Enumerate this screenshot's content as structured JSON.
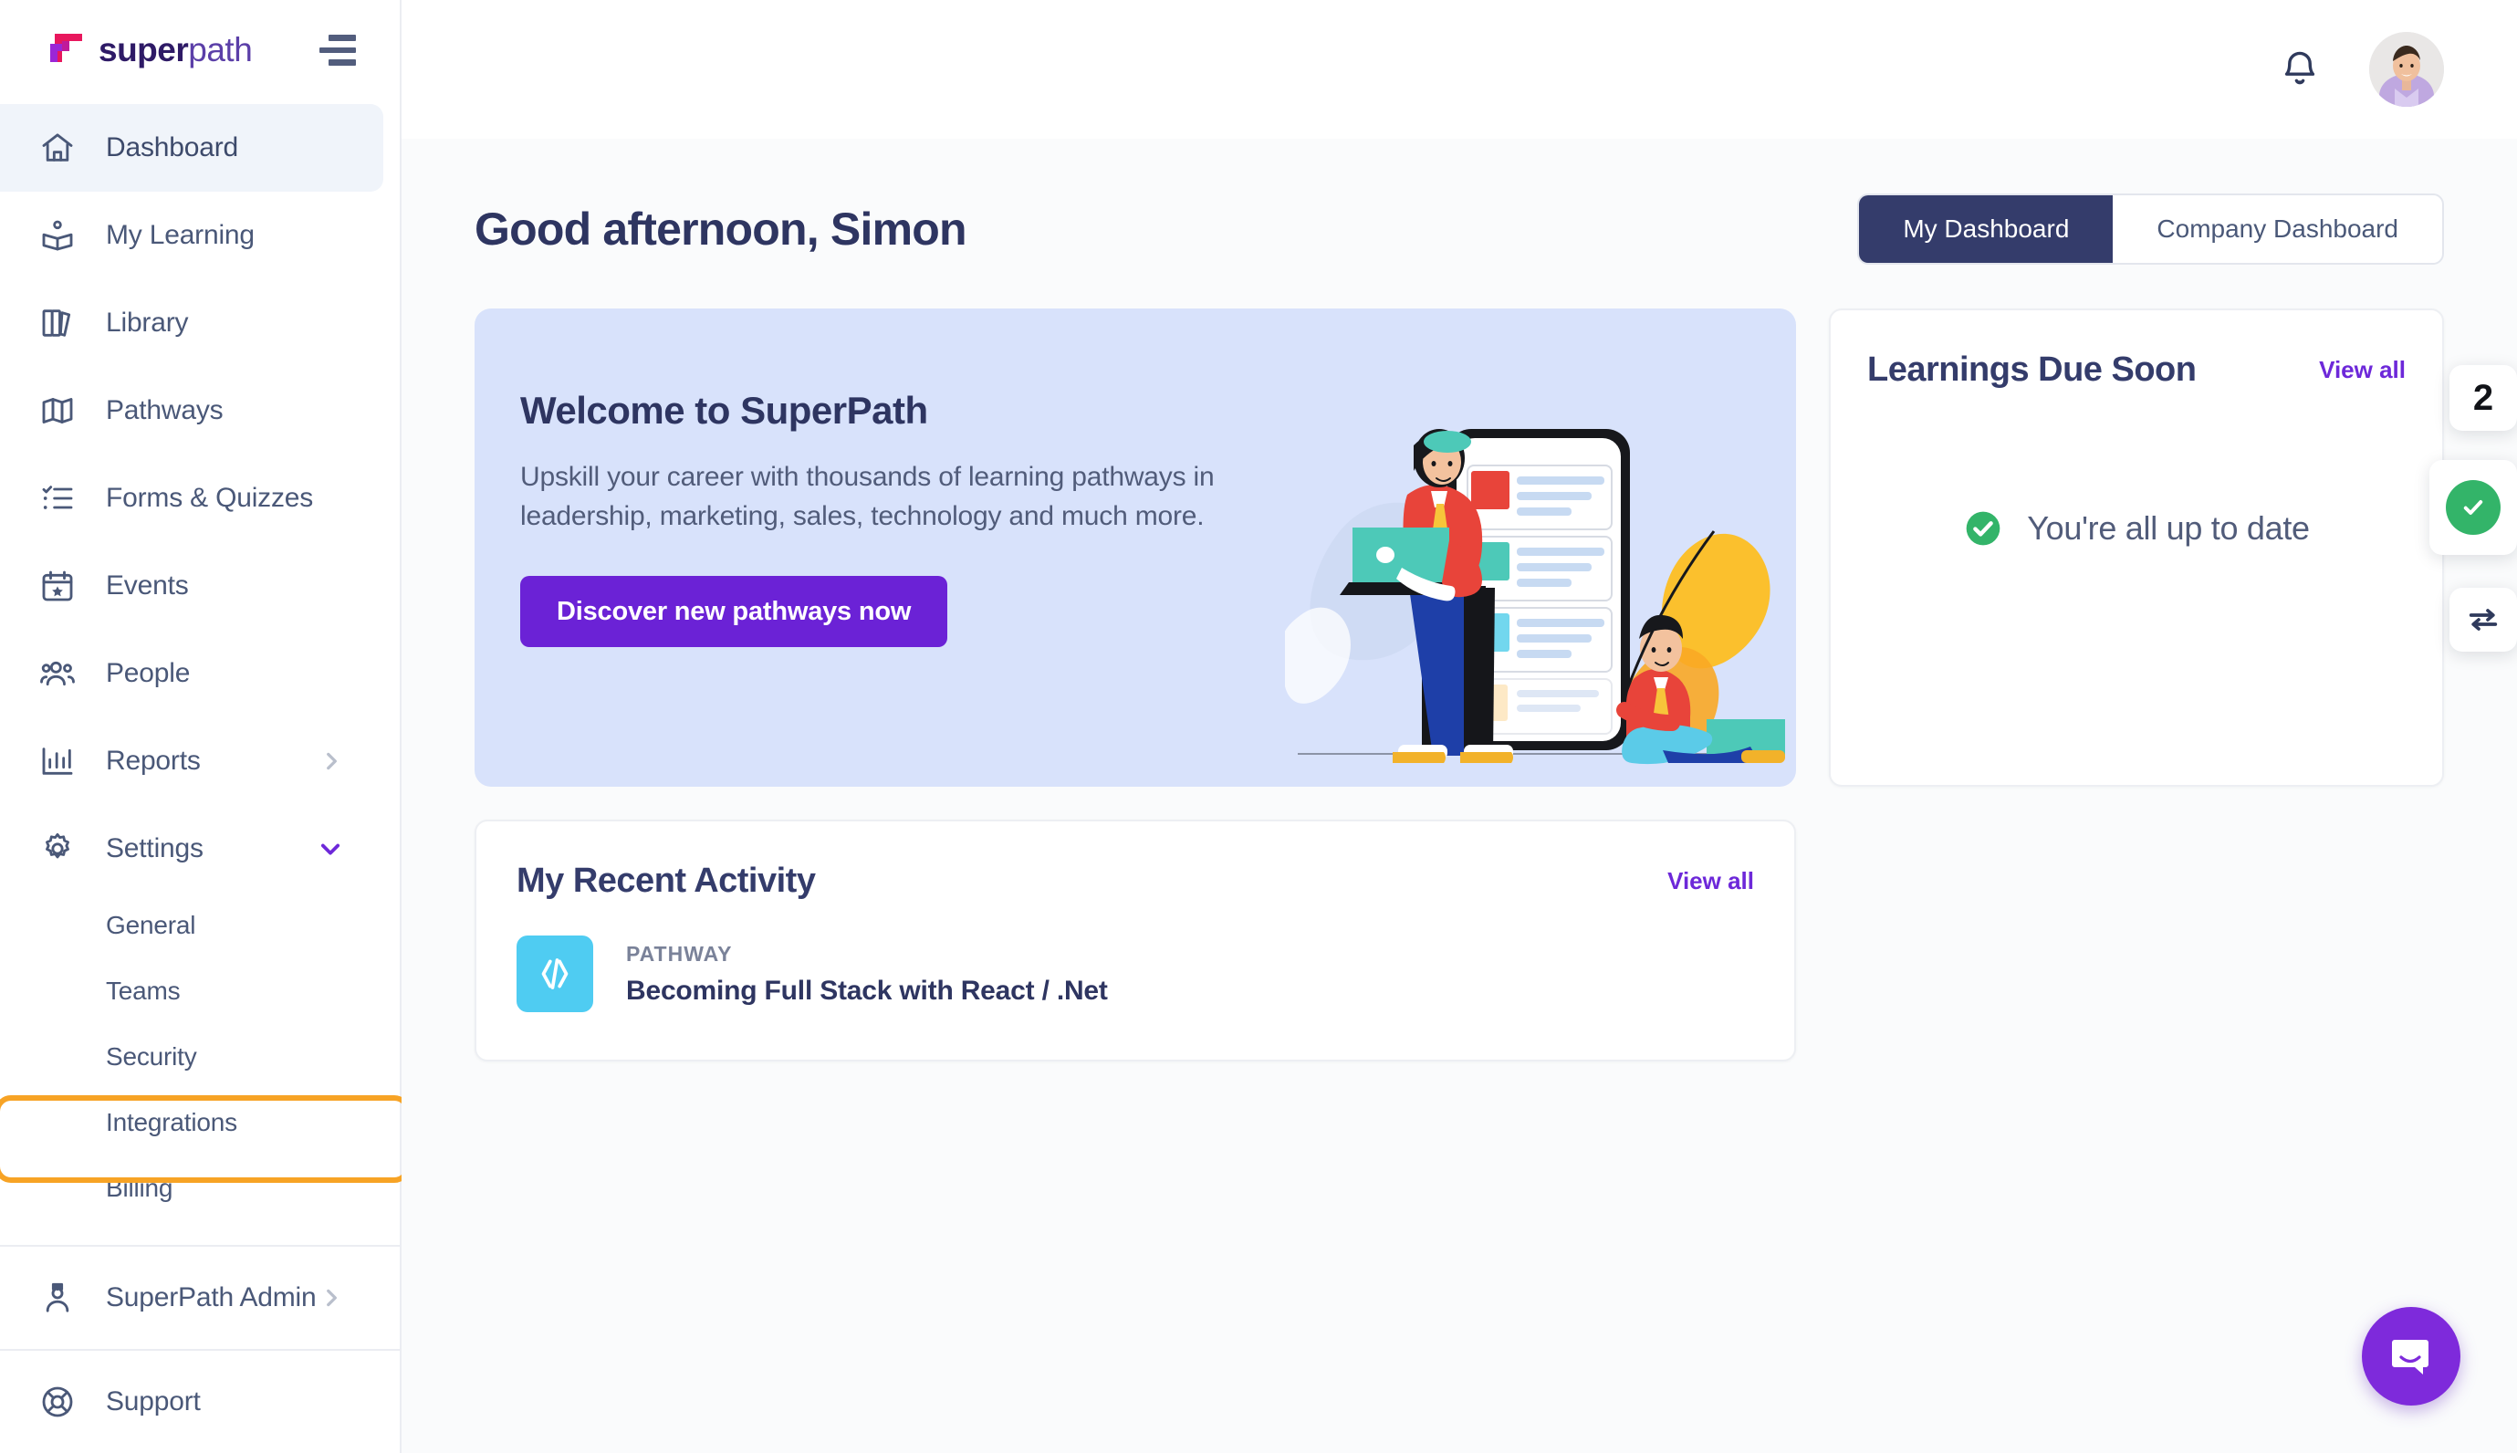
{
  "brand": {
    "logo_bold": "super",
    "logo_light": "path",
    "accent_purple": "#6B22D6",
    "accent_navy": "#343C6B",
    "highlight_orange": "#F7A325",
    "success_green": "#33B469"
  },
  "sidebar": {
    "menu_icon": "hamburger-icon",
    "items": [
      {
        "label": "Dashboard",
        "icon": "home-icon",
        "active": true,
        "chevron": "none"
      },
      {
        "label": "My Learning",
        "icon": "book-open-icon",
        "active": false,
        "chevron": "none"
      },
      {
        "label": "Library",
        "icon": "books-icon",
        "active": false,
        "chevron": "none"
      },
      {
        "label": "Pathways",
        "icon": "map-icon",
        "active": false,
        "chevron": "none"
      },
      {
        "label": "Forms & Quizzes",
        "icon": "checklist-icon",
        "active": false,
        "chevron": "none"
      },
      {
        "label": "Events",
        "icon": "calendar-star-icon",
        "active": false,
        "chevron": "none"
      },
      {
        "label": "People",
        "icon": "users-icon",
        "active": false,
        "chevron": "none"
      },
      {
        "label": "Reports",
        "icon": "bar-chart-icon",
        "active": false,
        "chevron": "right"
      },
      {
        "label": "Settings",
        "icon": "gear-icon",
        "active": false,
        "chevron": "down"
      }
    ],
    "settings_children": [
      {
        "label": "General"
      },
      {
        "label": "Teams"
      },
      {
        "label": "Security"
      },
      {
        "label": "Integrations",
        "highlighted": true
      },
      {
        "label": "Billing"
      }
    ],
    "footer_items": [
      {
        "label": "SuperPath Admin",
        "icon": "admin-user-icon",
        "chevron": "right"
      },
      {
        "label": "Support",
        "icon": "lifebuoy-icon",
        "chevron": "none"
      }
    ]
  },
  "topbar": {
    "notifications_icon": "bell-icon",
    "avatar": "user-avatar"
  },
  "header": {
    "greeting": "Good afternoon, Simon",
    "tabs": [
      {
        "label": "My Dashboard",
        "active": true
      },
      {
        "label": "Company Dashboard",
        "active": false
      }
    ]
  },
  "banner": {
    "title": "Welcome to SuperPath",
    "body": "Upskill your career with thousands of learning pathways in leadership, marketing, sales, technology and much more.",
    "cta_label": "Discover new pathways now",
    "illustration": "people-learning-illustration"
  },
  "activity": {
    "title": "My Recent Activity",
    "view_all_label": "View all",
    "items": [
      {
        "kind": "PATHWAY",
        "title": "Becoming Full Stack with React / .Net",
        "icon": "code-brackets-icon"
      }
    ]
  },
  "due_soon": {
    "title": "Learnings Due Soon",
    "view_all_label": "View all",
    "empty_state": "You're all up to date",
    "empty_icon": "check-circle-icon"
  },
  "edge_widgets": [
    {
      "name": "badge-count",
      "value": "2",
      "icon": "none"
    },
    {
      "name": "status-ok",
      "value": "",
      "icon": "check-circle-icon"
    },
    {
      "name": "swap-arrows",
      "value": "",
      "icon": "arrows-left-right-icon"
    }
  ],
  "chat": {
    "icon": "intercom-chat-icon"
  }
}
